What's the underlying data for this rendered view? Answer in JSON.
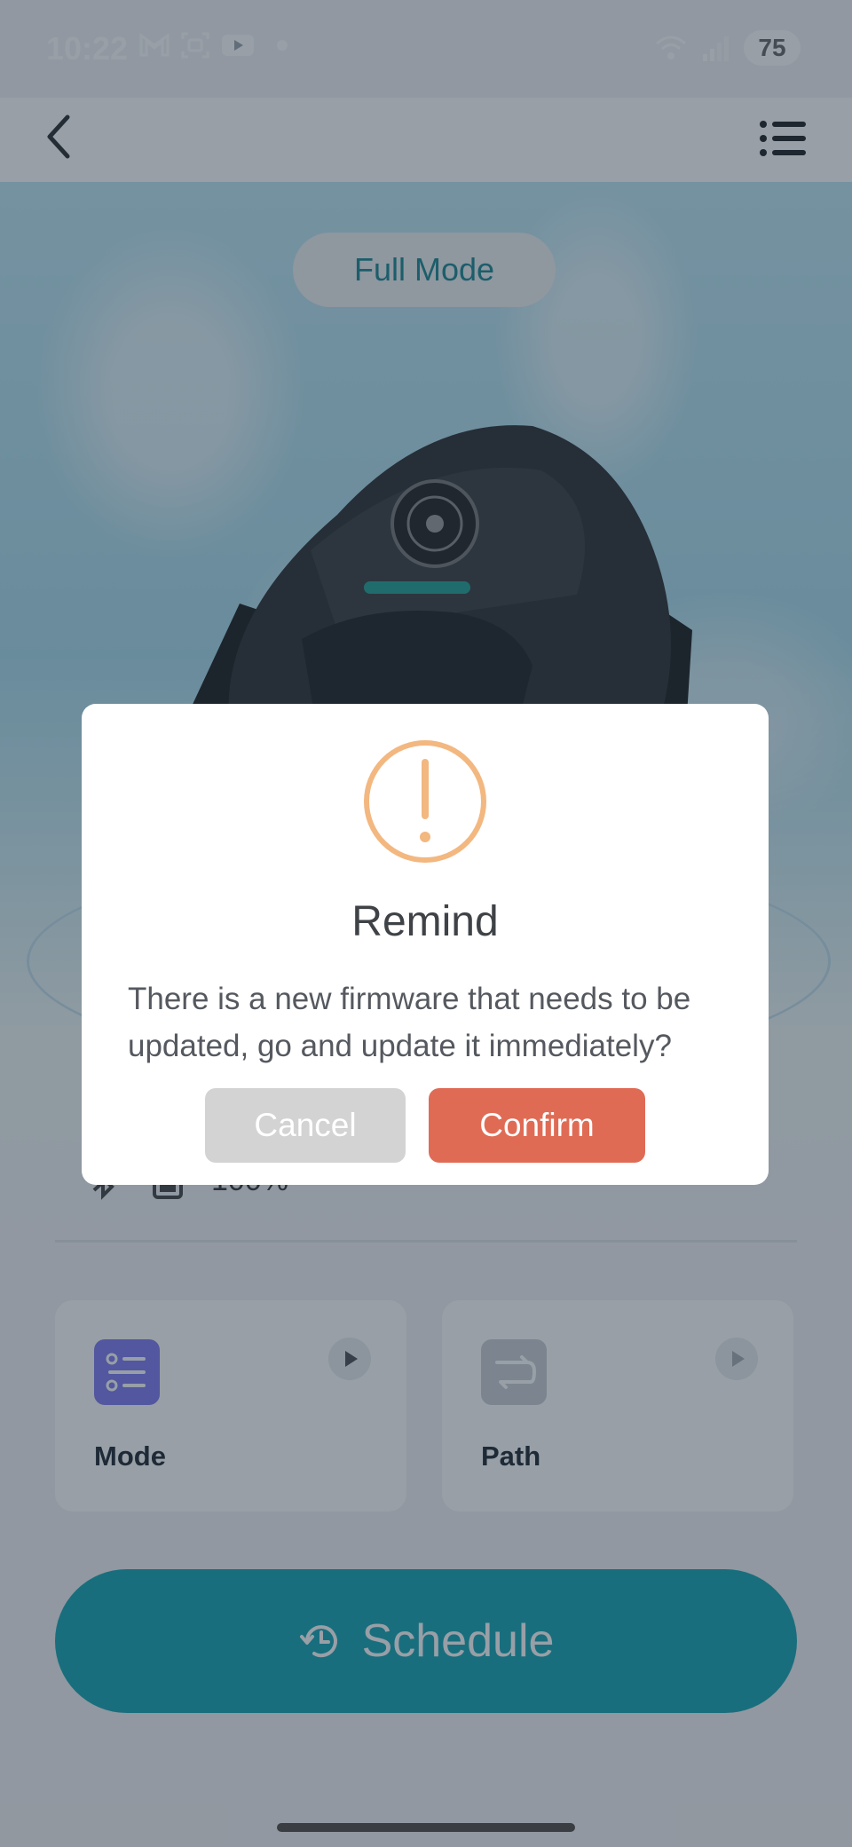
{
  "status_bar": {
    "time": "10:22",
    "battery": "75",
    "icons": [
      "gmail-icon",
      "screenshot-icon",
      "youtube-icon",
      "notification-dot",
      "wifi-icon",
      "signal-icon"
    ]
  },
  "header": {
    "back_icon": "chevron-left-icon",
    "menu_icon": "list-menu-icon"
  },
  "hero": {
    "mode_pill": "Full Mode",
    "battery_text": "100%"
  },
  "cards": [
    {
      "label": "Mode",
      "icon": "mode-settings-icon"
    },
    {
      "label": "Path",
      "icon": "path-icon"
    }
  ],
  "schedule": {
    "label": "Schedule",
    "icon": "clock-history-icon"
  },
  "dialog": {
    "title": "Remind",
    "message": "There is a new firmware that needs to be updated, go and update it immediately?",
    "cancel_label": "Cancel",
    "confirm_label": "Confirm"
  },
  "colors": {
    "accent": "#15a5b4",
    "confirm": "#e06b55",
    "cancel": "#d3d3d3",
    "warning": "#f3b780",
    "mode_icon": "#7f7bf2"
  }
}
